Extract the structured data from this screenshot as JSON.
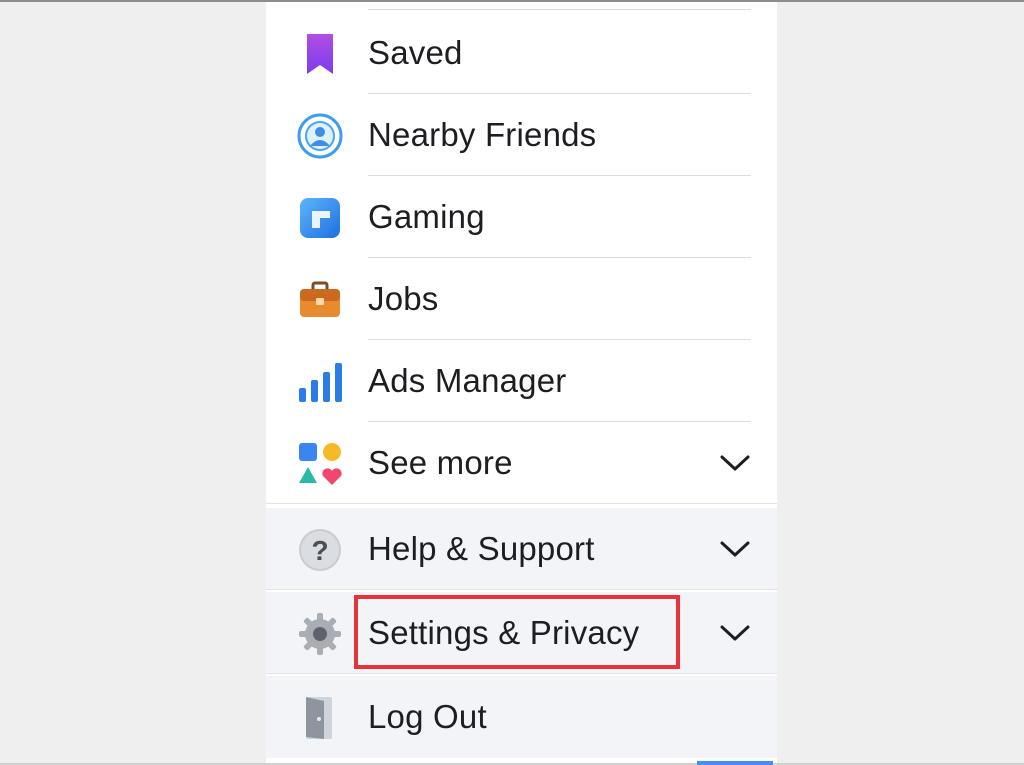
{
  "menu": {
    "items": [
      {
        "label": "Saved",
        "icon": "bookmark-icon"
      },
      {
        "label": "Nearby Friends",
        "icon": "nearby-friends-icon"
      },
      {
        "label": "Gaming",
        "icon": "gaming-icon"
      },
      {
        "label": "Jobs",
        "icon": "briefcase-icon"
      },
      {
        "label": "Ads Manager",
        "icon": "bar-chart-icon"
      },
      {
        "label": "See more",
        "icon": "shapes-icon",
        "expandable": true
      }
    ],
    "sections": [
      {
        "label": "Help & Support",
        "icon": "question-mark-icon",
        "expandable": true
      },
      {
        "label": "Settings & Privacy",
        "icon": "gear-icon",
        "expandable": true,
        "highlighted": true
      },
      {
        "label": "Log Out",
        "icon": "door-icon"
      }
    ]
  },
  "colors": {
    "highlight": "#e8323a",
    "section_background": "#f2f4f7",
    "text": "#1c1e21"
  }
}
